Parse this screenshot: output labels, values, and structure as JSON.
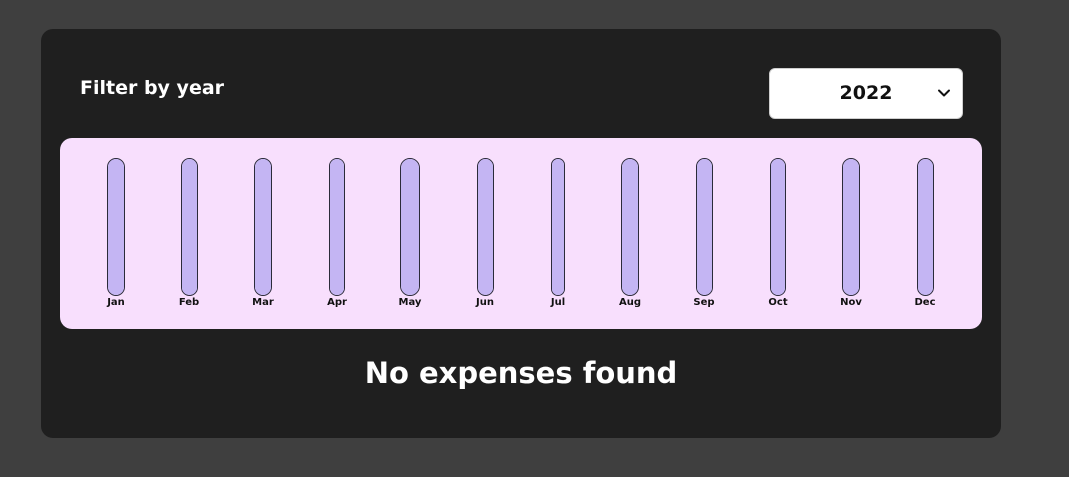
{
  "filter": {
    "label": "Filter by year",
    "selected_year": "2022"
  },
  "chart_data": {
    "type": "bar",
    "categories": [
      "Jan",
      "Feb",
      "Mar",
      "Apr",
      "May",
      "Jun",
      "Jul",
      "Aug",
      "Sep",
      "Oct",
      "Nov",
      "Dec"
    ],
    "values": [
      0,
      0,
      0,
      0,
      0,
      0,
      0,
      0,
      0,
      0,
      0,
      0
    ]
  },
  "expenses": {
    "empty_message": "No expenses found"
  },
  "colors": {
    "page_background": "#3f3f3f",
    "panel_background": "#1f1f1f",
    "chart_background": "#f8dffd",
    "bar_track": "#c4b5f3",
    "text_light": "#ffffff"
  }
}
